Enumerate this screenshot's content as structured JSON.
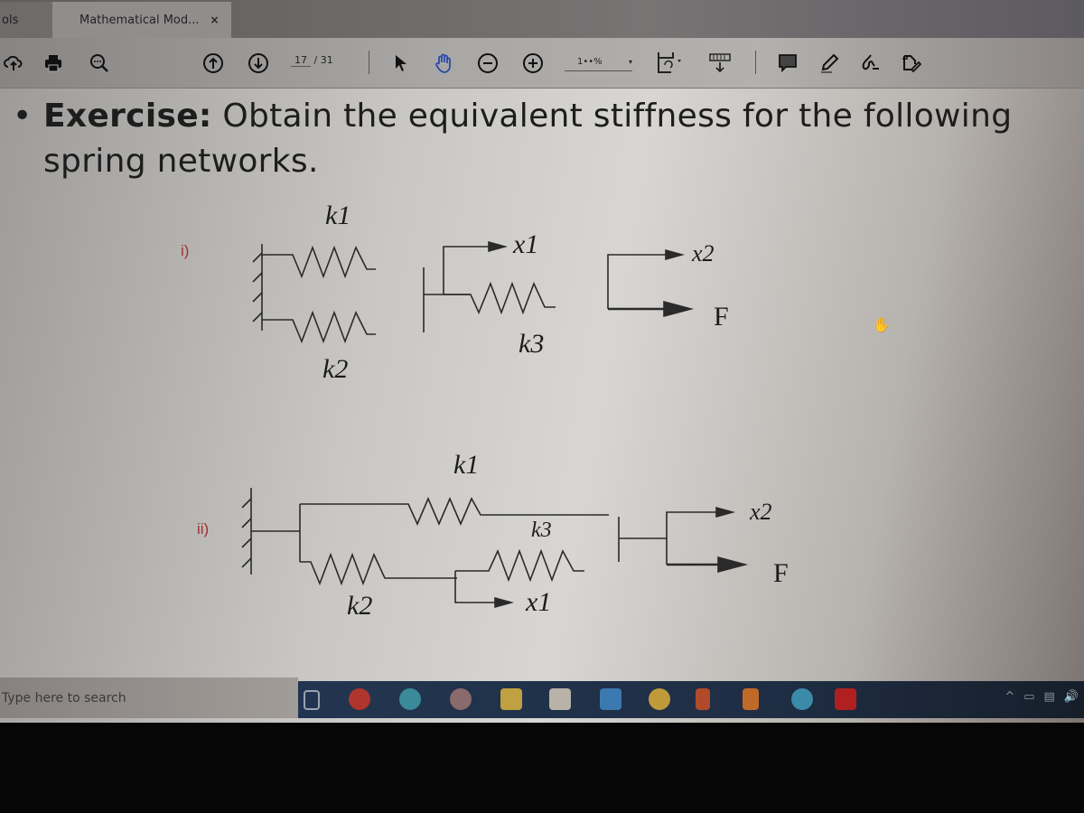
{
  "tabs": [
    {
      "label": "ols",
      "active": false
    },
    {
      "label": "Mathematical Mod...",
      "active": true,
      "close": "×"
    }
  ],
  "toolbar": {
    "left_icons": [
      "upload-cloud-icon",
      "print-icon",
      "search-zoom-icon"
    ],
    "nav_icons": [
      "prev-page-icon",
      "next-page-icon"
    ],
    "page_current": "17",
    "page_total": "/ 31",
    "tools": [
      "select-arrow-icon",
      "hand-tool-icon",
      "zoom-out-icon",
      "zoom-in-icon"
    ],
    "zoom_value": "1••%",
    "zoom_arrow": "▾",
    "right_icons": [
      "fit-page-icon",
      "scroll-mode-icon",
      "comment-icon",
      "highlight-pen-icon",
      "sign-icon",
      "share-icon"
    ]
  },
  "document": {
    "heading_bold": "Exercise:",
    "heading_rest": " Obtain the equivalent stiffness for the following",
    "heading_line2": "spring networks.",
    "exercises": [
      {
        "label": "i)",
        "labels": {
          "k1": "k1",
          "k2": "k2",
          "k3": "k3",
          "x1": "x1",
          "x2": "x2",
          "F": "F"
        }
      },
      {
        "label": "ii)",
        "labels": {
          "k1": "k1",
          "k2": "k2",
          "k3": "k3",
          "x1": "x1",
          "x2": "x2",
          "F": "F"
        }
      }
    ]
  },
  "taskbar": {
    "search_placeholder": "Type here to search",
    "apps": [
      {
        "name": "task-view",
        "color": "#9aa3b0"
      },
      {
        "name": "psiphon",
        "color": "#b0352c"
      },
      {
        "name": "edge",
        "color": "#3a8a9a"
      },
      {
        "name": "chrome-alt",
        "color": "#8a6a6a"
      },
      {
        "name": "file-explorer",
        "color": "#c0a040"
      },
      {
        "name": "store",
        "color": "#b8b2a8"
      },
      {
        "name": "mail",
        "color": "#3a7ab0"
      },
      {
        "name": "chrome",
        "color": "#c09a3a"
      },
      {
        "name": "office",
        "color": "#b04a2a"
      },
      {
        "name": "matlab",
        "color": "#c06a2a"
      },
      {
        "name": "telegram",
        "color": "#3a8aa8"
      },
      {
        "name": "acrobat",
        "color": "#b02020"
      }
    ],
    "tray": [
      "^",
      "▭",
      "▤",
      "🔊"
    ]
  }
}
